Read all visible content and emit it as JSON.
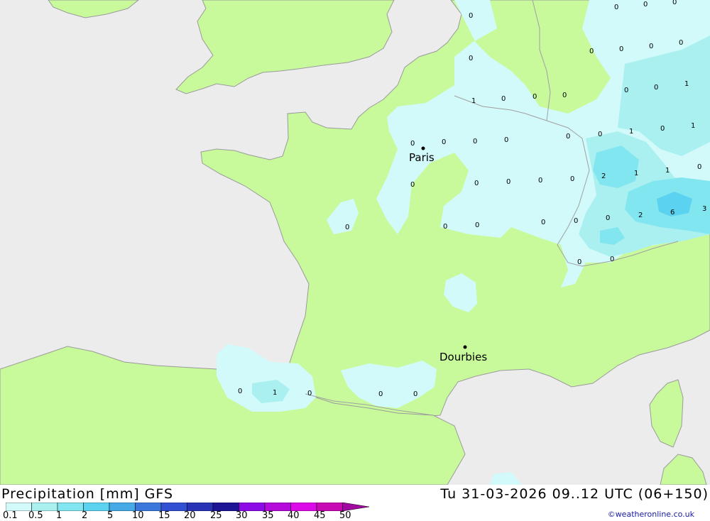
{
  "footer": {
    "title": "Precipitation [mm] GFS",
    "datetime": "Tu 31-03-2026 09..12 UTC (06+150)",
    "credit": "©weatheronline.co.uk"
  },
  "legend": {
    "ticks": [
      "0.1",
      "0.5",
      "1",
      "2",
      "5",
      "10",
      "15",
      "20",
      "25",
      "30",
      "35",
      "40",
      "45",
      "50"
    ],
    "colors": [
      "#d2fafa",
      "#aaf0f0",
      "#82e6f0",
      "#5ad2f0",
      "#46aae6",
      "#3c78dc",
      "#3250d2",
      "#2832b4",
      "#1e1496",
      "#8c0ae6",
      "#b40adc",
      "#dc0ae6",
      "#c80ab4",
      "#a00aa0"
    ]
  },
  "map": {
    "colors": {
      "sea": "#ececec",
      "land": "#c8fa9c",
      "precip_light": "#d2fafa",
      "precip_mid": "#aaf0f0",
      "precip_heavy": "#82e6f0",
      "precip_max": "#5ad2f0"
    },
    "cities": [
      {
        "name": "Paris"
      },
      {
        "name": "Dourbies"
      }
    ],
    "values": [
      "0",
      "0",
      "0",
      "0",
      "0",
      "0",
      "0",
      "0",
      "0",
      "0",
      "1",
      "0",
      "0",
      "0",
      "1",
      "0",
      "0",
      "0",
      "0",
      "0",
      "0",
      "0",
      "0",
      "1",
      "0",
      "1",
      "0",
      "0",
      "2",
      "1",
      "1",
      "0",
      "0",
      "0",
      "0",
      "0",
      "0",
      "0",
      "2",
      "6",
      "3",
      "0",
      "0",
      "0",
      "0",
      "0",
      "0",
      "0",
      "1",
      "0",
      "0",
      "0"
    ]
  }
}
